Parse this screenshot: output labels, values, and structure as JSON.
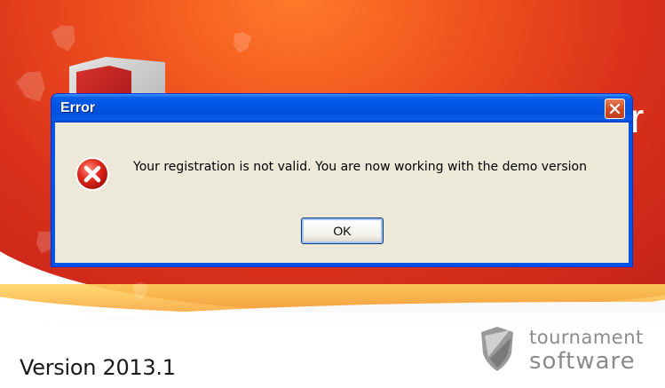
{
  "dialog": {
    "title": "Error",
    "message": "Your registration is not valid. You are now working with the demo version",
    "ok_label": "OK",
    "icon": "error-icon",
    "close_icon": "close-icon"
  },
  "splash": {
    "version": "Version 2013.1",
    "brand_line1": "tournament",
    "brand_line2": "software",
    "title_fragment": "r"
  },
  "colors": {
    "titlebar": "#0055e5",
    "dialog_body": "#ece9d8",
    "splash_red": "#e0381c",
    "brand_gray": "#8b8b8b"
  }
}
